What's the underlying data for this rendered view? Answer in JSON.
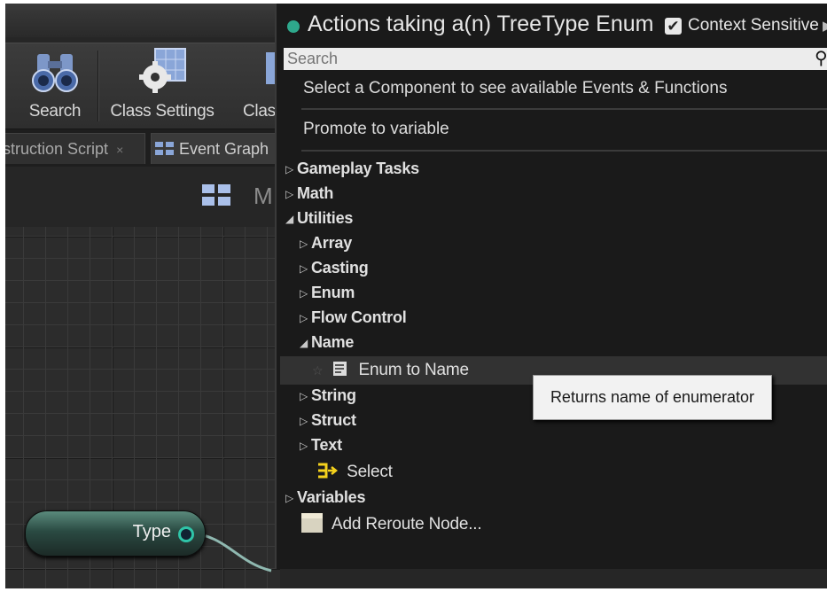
{
  "toolbar": {
    "search_label": "Search",
    "class_settings_label": "Class Settings",
    "class_defaults_label": "Clas"
  },
  "tabs": {
    "construction_script": "struction Script",
    "construction_close": "×",
    "event_graph": "Event Graph"
  },
  "graph": {
    "title_fragment": "M",
    "node_label": "Type"
  },
  "menu": {
    "title": "Actions taking a(n) TreeType Enum",
    "context_sensitive_label": "Context Sensitive",
    "context_sensitive_checked": true,
    "search_placeholder": "Search",
    "info_text": "Select a Component to see available Events & Functions",
    "promote_label": "Promote to variable",
    "items": [
      {
        "label": "Gameplay Tasks",
        "expanded": false
      },
      {
        "label": "Math",
        "expanded": false
      },
      {
        "label": "Utilities",
        "expanded": true
      },
      {
        "label": "Array",
        "expanded": false
      },
      {
        "label": "Casting",
        "expanded": false
      },
      {
        "label": "Enum",
        "expanded": false
      },
      {
        "label": "Flow Control",
        "expanded": false
      },
      {
        "label": "Name",
        "expanded": true
      },
      {
        "label": "Enum to Name",
        "icon": "function-icon"
      },
      {
        "label": "String",
        "expanded": false
      },
      {
        "label": "Struct",
        "expanded": false
      },
      {
        "label": "Text",
        "expanded": false
      },
      {
        "label": "Select",
        "icon": "select-node-icon"
      },
      {
        "label": "Variables",
        "expanded": false
      },
      {
        "label": "Add Reroute Node...",
        "icon": "reroute-node-icon"
      }
    ],
    "tooltip": "Returns name of enumerator"
  },
  "colors": {
    "accent_teal": "#2ea88c",
    "select_icon_yellow": "#f5d21c"
  }
}
